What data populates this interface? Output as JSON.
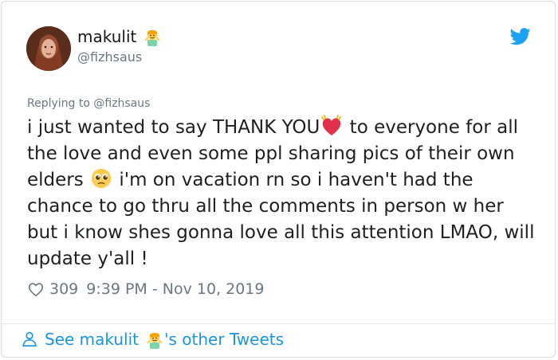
{
  "tweet": {
    "user": {
      "name": "makulit",
      "handle": "@fizhsaus"
    },
    "replying_to_prefix": "Replying to",
    "replying_to_handle": "@fizhsaus",
    "text_part1": "i just wanted to say THANK YOU",
    "text_part2": " to everyone for all the love and even some ppl sharing pics of their own elders ",
    "text_part3": " i'm on vacation rn so i haven't had the chance to go thru all the comments in person w her but i know shes gonna love all this attention LMAO, will update y'all !",
    "likes": "309",
    "timestamp": "9:39 PM - Nov 10, 2019"
  },
  "footer": {
    "see_prefix": "See makulit",
    "see_suffix": "'s other Tweets"
  },
  "colors": {
    "link_blue": "#1b95e0",
    "gray_text": "#697882",
    "body_text": "#1c2022",
    "twitter_blue": "#1da1f2"
  },
  "icons": {
    "verified_like_emoji": "person-raising-hands-emoji",
    "heart_emoji": "sparkling-heart-emoji",
    "pleading_emoji": "pleading-face-emoji",
    "like_icon": "heart-outline-icon",
    "brand_icon": "twitter-bird-icon",
    "profile_icon": "person-icon"
  }
}
